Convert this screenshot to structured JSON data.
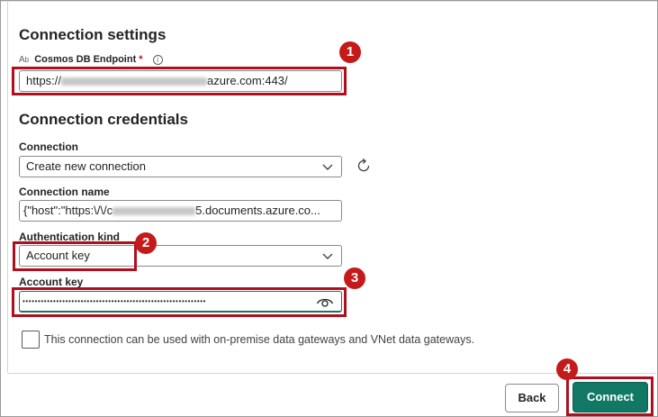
{
  "settings": {
    "title": "Connection settings",
    "endpoint_label": "Cosmos DB Endpoint",
    "required_mark": "*",
    "endpoint_prefix": "https://",
    "endpoint_suffix": "azure.com:443/"
  },
  "credentials": {
    "title": "Connection credentials",
    "connection_label": "Connection",
    "connection_value": "Create new connection",
    "name_label": "Connection name",
    "name_prefix": "{\"host\":\"https:\\/\\/c",
    "name_suffix": "5.documents.azure.co...",
    "auth_label": "Authentication kind",
    "auth_value": "Account key",
    "key_label": "Account key",
    "key_value": "••••••••••••••••••••••••••••••••••••••••••••••••••••••••••••"
  },
  "gateway": {
    "label": "This connection can be used with on-premise data gateways and VNet data gateways."
  },
  "footer": {
    "back_label": "Back",
    "connect_label": "Connect"
  },
  "callouts": [
    "1",
    "2",
    "3",
    "4"
  ],
  "colors": {
    "accent": "#117865",
    "callout": "#b0101e"
  }
}
